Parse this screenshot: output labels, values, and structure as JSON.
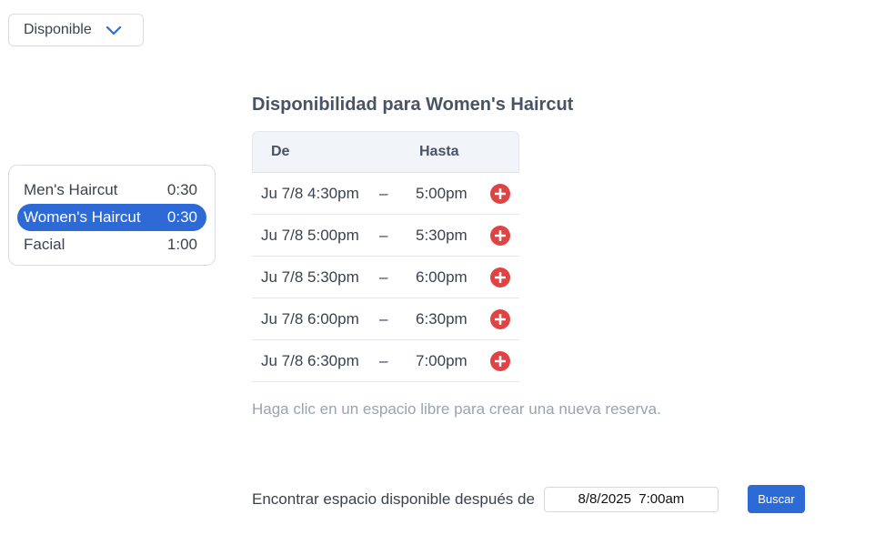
{
  "status_select": {
    "value": "Disponible",
    "icon": "chevron-down-icon"
  },
  "services": [
    {
      "name": "Men's Haircut",
      "duration": "0:30",
      "selected": false
    },
    {
      "name": "Women's Haircut",
      "duration": "0:30",
      "selected": true
    },
    {
      "name": "Facial",
      "duration": "1:00",
      "selected": false
    }
  ],
  "panel": {
    "title": "Disponibilidad para Women's Haircut",
    "columns": {
      "from": "De",
      "to": "Hasta"
    },
    "slots": [
      {
        "from": "Ju 7/8 4:30pm",
        "dash": "–",
        "to": "5:00pm"
      },
      {
        "from": "Ju 7/8 5:00pm",
        "dash": "–",
        "to": "5:30pm"
      },
      {
        "from": "Ju 7/8 5:30pm",
        "dash": "–",
        "to": "6:00pm"
      },
      {
        "from": "Ju 7/8 6:00pm",
        "dash": "–",
        "to": "6:30pm"
      },
      {
        "from": "Ju 7/8 6:30pm",
        "dash": "–",
        "to": "7:00pm"
      }
    ],
    "hint": "Haga clic en un espacio libre para crear una nueva reserva."
  },
  "find": {
    "label": "Encontrar espacio disponible después de",
    "date_value": "8/8/2025  7:00am",
    "button_label": "Buscar"
  },
  "colors": {
    "accent": "#2e6ad6",
    "add": "#e04343"
  }
}
